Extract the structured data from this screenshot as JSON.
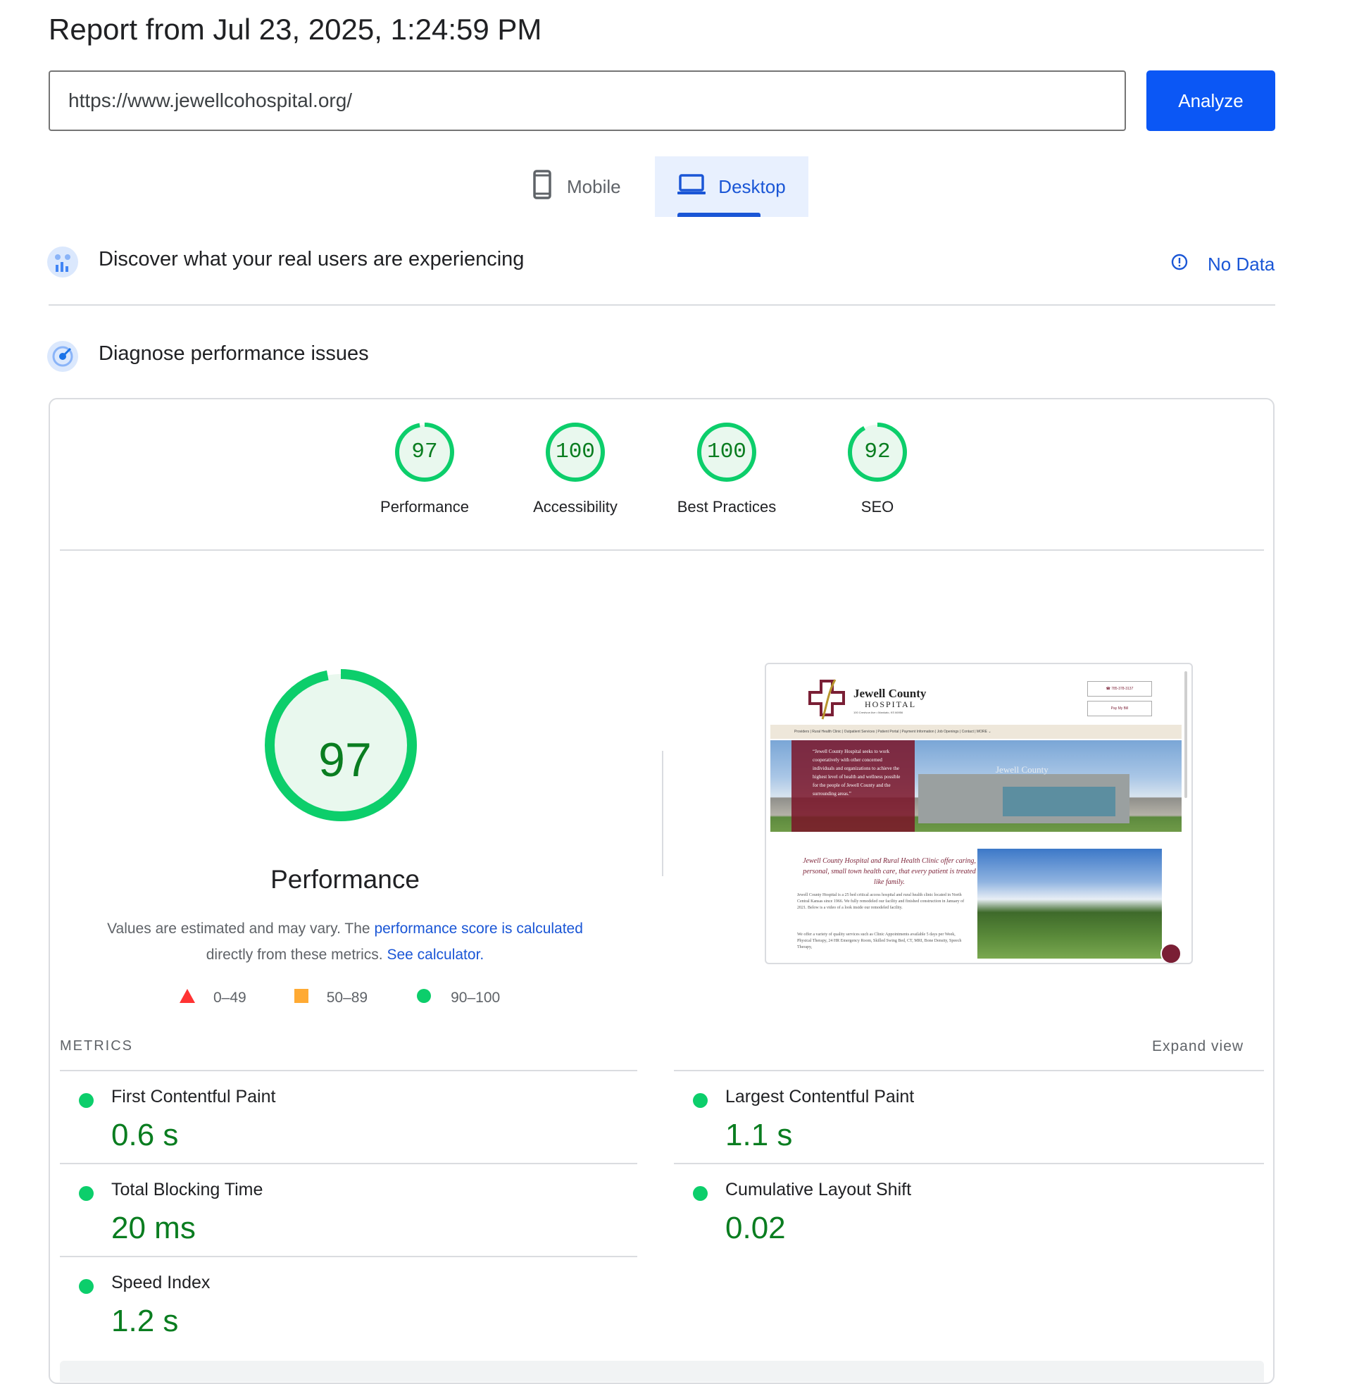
{
  "report": {
    "title": "Report from Jul 23, 2025, 1:24:59 PM"
  },
  "search": {
    "url": "https://www.jewellcohospital.org/",
    "analyze_label": "Analyze"
  },
  "tabs": [
    {
      "label": "Mobile",
      "active": false
    },
    {
      "label": "Desktop",
      "active": true
    }
  ],
  "field_data": {
    "title": "Discover what your real users are experiencing",
    "no_data_label": "No Data"
  },
  "lab": {
    "title": "Diagnose performance issues"
  },
  "gauges": [
    {
      "label": "Performance",
      "score": 97
    },
    {
      "label": "Accessibility",
      "score": 100
    },
    {
      "label": "Best Practices",
      "score": 100
    },
    {
      "label": "SEO",
      "score": 92
    }
  ],
  "performance": {
    "score": 97,
    "label": "Performance",
    "explain_1": "Values are estimated and may vary. The ",
    "link_1": "performance score is calculated",
    "explain_2": " directly from these metrics. ",
    "link_2": "See calculator."
  },
  "legend": [
    {
      "range": "0–49",
      "shape": "triangle",
      "color": "#ff3333"
    },
    {
      "range": "50–89",
      "shape": "square",
      "color": "#ffaa33"
    },
    {
      "range": "90–100",
      "shape": "circle",
      "color": "#0cce6b"
    }
  ],
  "metrics": {
    "heading": "METRICS",
    "expand_label": "Expand view",
    "items": [
      {
        "name": "First Contentful Paint",
        "value": "0.6 s"
      },
      {
        "name": "Largest Contentful Paint",
        "value": "1.1 s"
      },
      {
        "name": "Total Blocking Time",
        "value": "20 ms"
      },
      {
        "name": "Cumulative Layout Shift",
        "value": "0.02"
      },
      {
        "name": "Speed Index",
        "value": "1.2 s"
      }
    ]
  },
  "preview": {
    "logo_name": "Jewell County",
    "logo_sub": "HOSPITAL",
    "address": "100 Crestvue Ave • Mankato, KS 66956",
    "phone": "☎ 785-378-3137",
    "pay_label": "Pay My Bill",
    "nav": "Providers | Rural Health Clinic | Outpatient Services | Patient Portal | Payment Information | Job Openings | Contact | MORE ⌄",
    "quote": "“Jewell County Hospital seeks to work cooperatively with other concerned individuals and organizations to achieve the highest level of health and wellness possible for the people of Jewell County and the surrounding areas.”",
    "building_sign": "Jewell County",
    "tagline": "Jewell County Hospital and Rural Health Clinic offer caring, personal, small town health care, that every patient is treated like family.",
    "body_1": "Jewell County Hospital is a 25 bed critical access hospital and rural health clinic located in North Central Kansas since 1966. We fully remodeled our facility and finished construction in January of 2021. Below is a video of a look inside our remodeled facility.",
    "body_2": "We offer a variety of quality services such as Clinic Appointments available 5 days per Week, Physical Therapy, 24 HR Emergency Room, Skilled Swing Bed, CT, MRI, Bone Density, Speech Therapy,"
  },
  "colors": {
    "pass": "#0cce6b",
    "pass_text": "#0a7d20",
    "accent": "#1a56d6",
    "button": "#0b57f5"
  }
}
